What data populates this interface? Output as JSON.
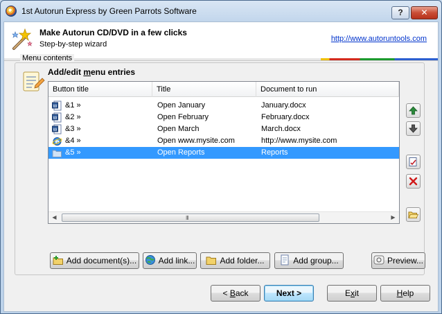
{
  "window": {
    "title": "1st Autorun Express by Green Parrots Software",
    "help_label": "?",
    "close_label": "✕"
  },
  "header": {
    "title": "Make Autorun CD/DVD in a few clicks",
    "subtitle": "Step-by-step wizard",
    "link": "http://www.autoruntools.com"
  },
  "group": {
    "legend": "Menu contents",
    "section_title_pre": "Add/edit ",
    "section_title_mnemonic": "m",
    "section_title_post": "enu entries"
  },
  "list": {
    "columns": [
      "Button title",
      "Title",
      "Document to run"
    ],
    "rows": [
      {
        "button_title": "&1 »",
        "title": "Open January",
        "document": "January.docx",
        "icon": "word-document-icon",
        "selected": false
      },
      {
        "button_title": "&2 »",
        "title": "Open February",
        "document": "February.docx",
        "icon": "word-document-icon",
        "selected": false
      },
      {
        "button_title": "&3 »",
        "title": "Open March",
        "document": "March.docx",
        "icon": "word-document-icon",
        "selected": false
      },
      {
        "button_title": "&4 »",
        "title": "Open www.mysite.com",
        "document": "http://www.mysite.com",
        "icon": "internet-explorer-icon",
        "selected": false
      },
      {
        "button_title": "&5 »",
        "title": "Open Reports",
        "document": "Reports",
        "icon": "folder-icon",
        "selected": true
      }
    ],
    "scroll_grip": "III"
  },
  "actions": {
    "add_document": "Add document(s)...",
    "add_link": "Add link...",
    "add_folder": "Add folder...",
    "add_group": "Add group...",
    "preview": "Preview..."
  },
  "nav": {
    "back_mnemonic": "B",
    "back_rest": "ack",
    "back_prefix": "< ",
    "next": "Next >",
    "exit_pre": "E",
    "exit_mnemonic": "x",
    "exit_post": "it",
    "help_mnemonic": "H",
    "help_rest": "elp"
  },
  "colors": {
    "selection": "#3399ff",
    "link": "#0033cc",
    "strip_yellow": "#f0c000",
    "strip_red": "#d42a1d",
    "strip_green": "#1c9a2e",
    "strip_blue": "#2b5fd0"
  }
}
